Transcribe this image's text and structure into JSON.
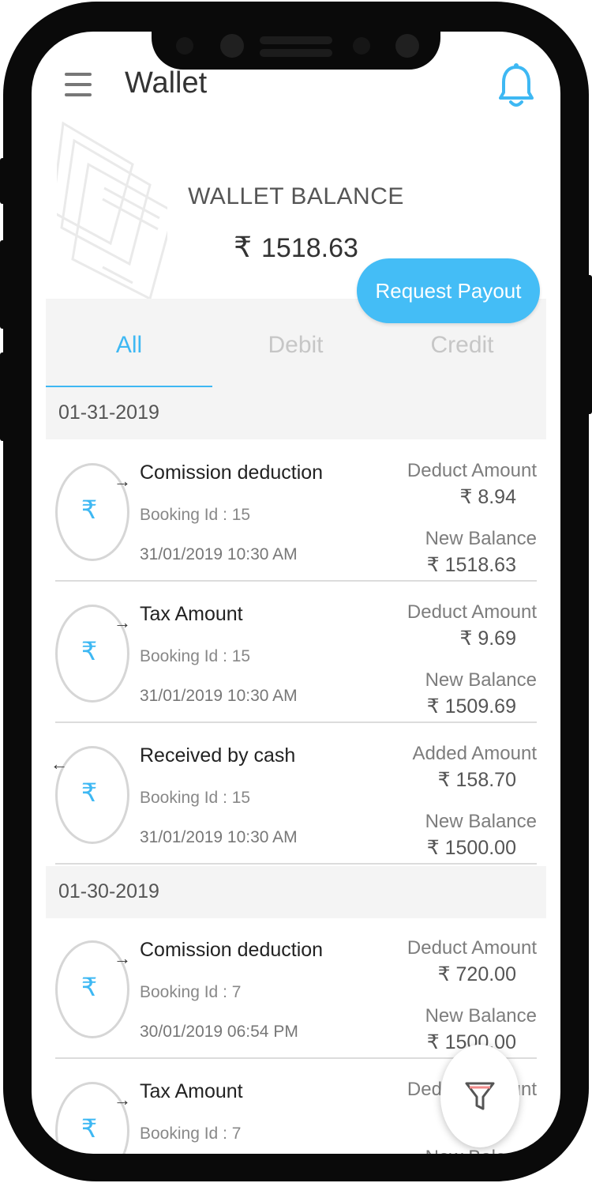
{
  "appbar": {
    "title": "Wallet"
  },
  "balance": {
    "label": "WALLET BALANCE",
    "currency_symbol": "₹",
    "amount": "1518.63"
  },
  "payout_button": {
    "label": "Request Payout"
  },
  "tabs": [
    {
      "label": "All",
      "active": true
    },
    {
      "label": "Debit",
      "active": false
    },
    {
      "label": "Credit",
      "active": false
    }
  ],
  "groups": [
    {
      "date": "01-31-2019",
      "items": [
        {
          "title": "Comission deduction",
          "booking": "Booking Id : 15",
          "datetime": "31/01/2019 10:30 AM",
          "direction": "out",
          "amount_label": "Deduct Amount",
          "amount": "₹ 8.94",
          "balance_label": "New Balance",
          "balance": "₹ 1518.63"
        },
        {
          "title": "Tax Amount",
          "booking": "Booking Id : 15",
          "datetime": "31/01/2019 10:30 AM",
          "direction": "out",
          "amount_label": "Deduct Amount",
          "amount": "₹ 9.69",
          "balance_label": "New Balance",
          "balance": "₹ 1509.69"
        },
        {
          "title": "Received by cash",
          "booking": "Booking Id : 15",
          "datetime": "31/01/2019 10:30 AM",
          "direction": "in",
          "amount_label": "Added Amount",
          "amount": "₹ 158.70",
          "balance_label": "New Balance",
          "balance": "₹ 1500.00"
        }
      ]
    },
    {
      "date": "01-30-2019",
      "items": [
        {
          "title": "Comission deduction",
          "booking": "Booking Id : 7",
          "datetime": "30/01/2019 06:54 PM",
          "direction": "out",
          "amount_label": "Deduct Amount",
          "amount": "₹ 720.00",
          "balance_label": "New Balance",
          "balance": "₹ 1500.00"
        },
        {
          "title": "Tax Amount",
          "booking": "Booking Id : 7",
          "datetime": "",
          "direction": "out",
          "amount_label": "Deduct Amount",
          "amount": "",
          "balance_label": "New Balance",
          "balance": ""
        }
      ]
    }
  ],
  "icons": {
    "menu": "hamburger-menu-icon",
    "notification": "bell-icon",
    "filter": "filter-funnel-icon",
    "transaction": "rupee-icon"
  },
  "colors": {
    "accent": "#3eb8f3",
    "button": "#44bdf6",
    "frame": "#0a0a0a"
  }
}
